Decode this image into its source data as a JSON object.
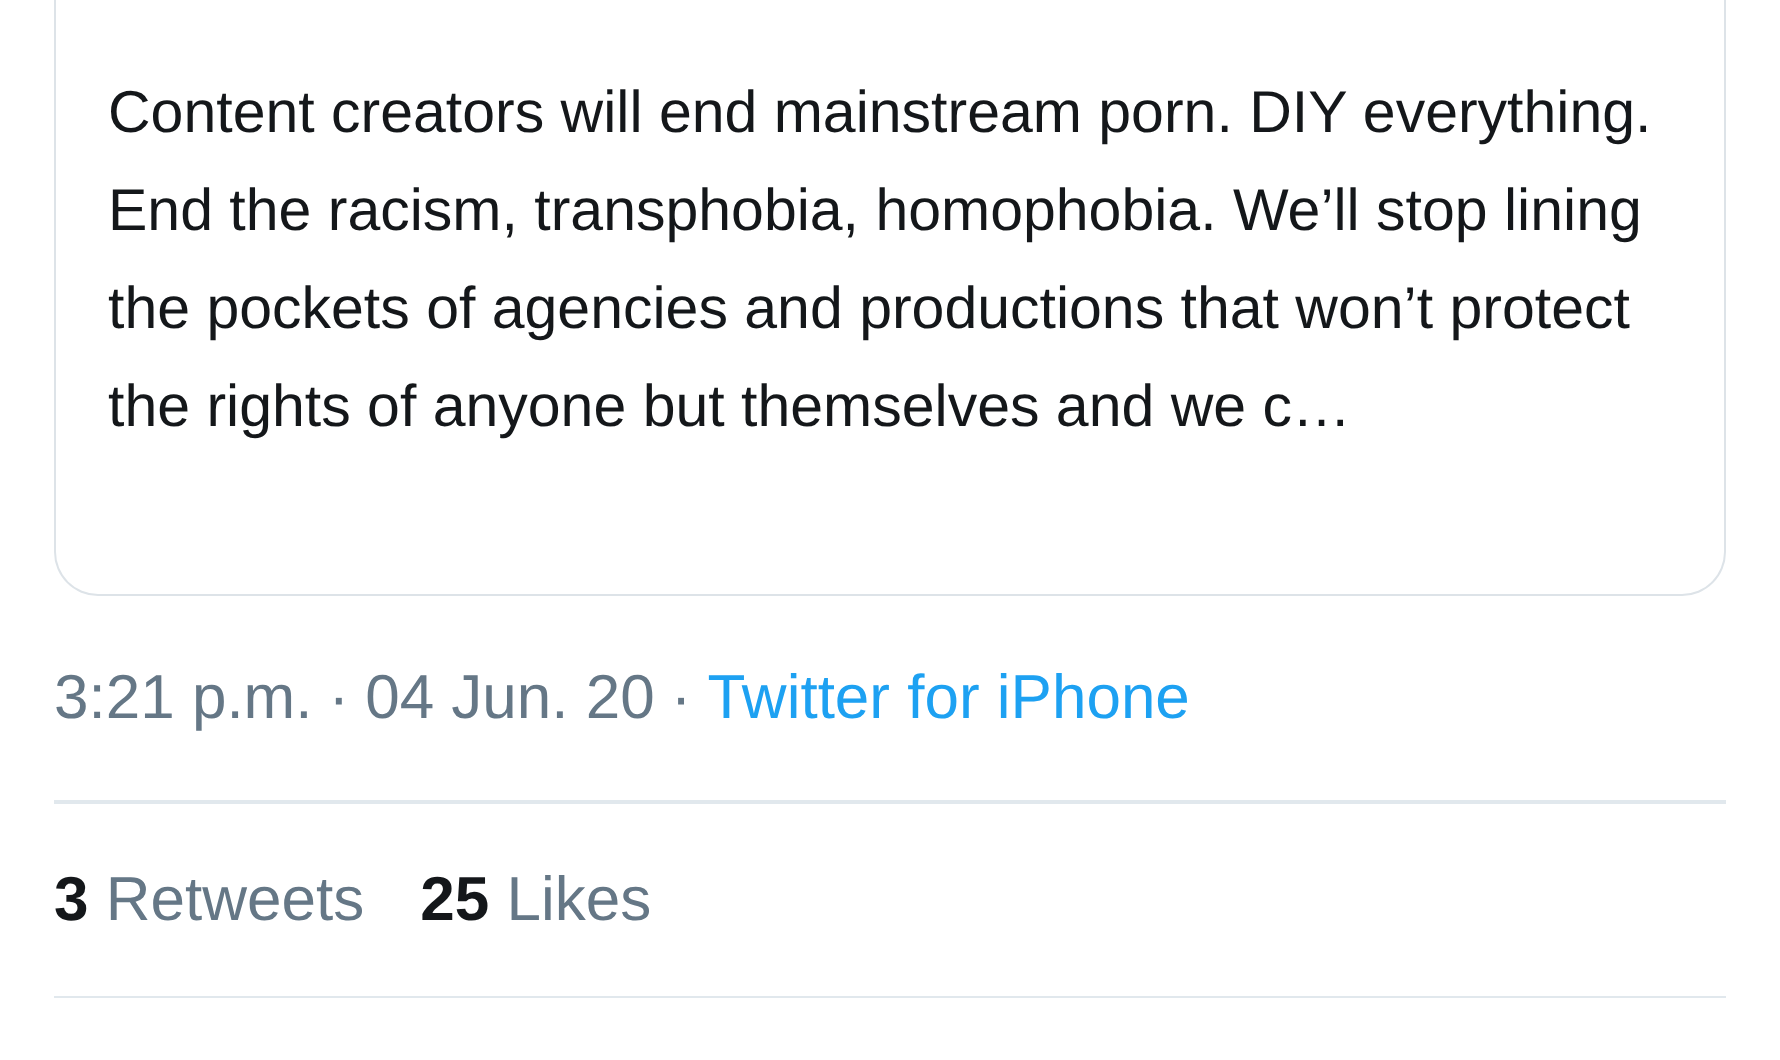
{
  "quoted_tweet": {
    "text": "Content creators will end mainstream porn. DIY everything. End the racism, transphobia, homophobia. We’ll stop lining the pockets of agencies and productions that won’t protect the rights of anyone but themselves and we c…"
  },
  "meta": {
    "time": "3:21 p.m.",
    "separator": "·",
    "date": "04 Jun. 20",
    "separator_2": "·",
    "source": "Twitter for iPhone"
  },
  "stats": [
    {
      "count": "3",
      "label": "Retweets"
    },
    {
      "count": "25",
      "label": "Likes"
    }
  ]
}
